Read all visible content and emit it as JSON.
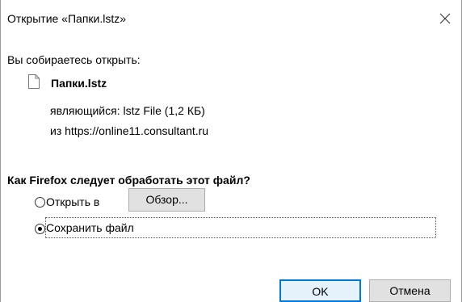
{
  "window": {
    "title": "Открытие «Папки.lstz»",
    "close_icon": "close-icon"
  },
  "prompt": "Вы собираетесь открыть:",
  "file": {
    "icon": "file-icon",
    "name": "Папки.lstz",
    "type_line": "являющийся: lstz File (1,2 КБ)",
    "source_line": "из https://online11.consultant.ru"
  },
  "question": "Как Firefox следует обработать этот файл?",
  "options": {
    "open_label": "Открыть в",
    "open_selected": false,
    "browse_label": "Обзор...",
    "save_label": "Сохранить файл",
    "save_selected": true
  },
  "buttons": {
    "ok_label": "OK",
    "cancel_label": "Отмена"
  },
  "colors": {
    "accent": "#0078d7",
    "button_bg": "#e1e1e1"
  }
}
